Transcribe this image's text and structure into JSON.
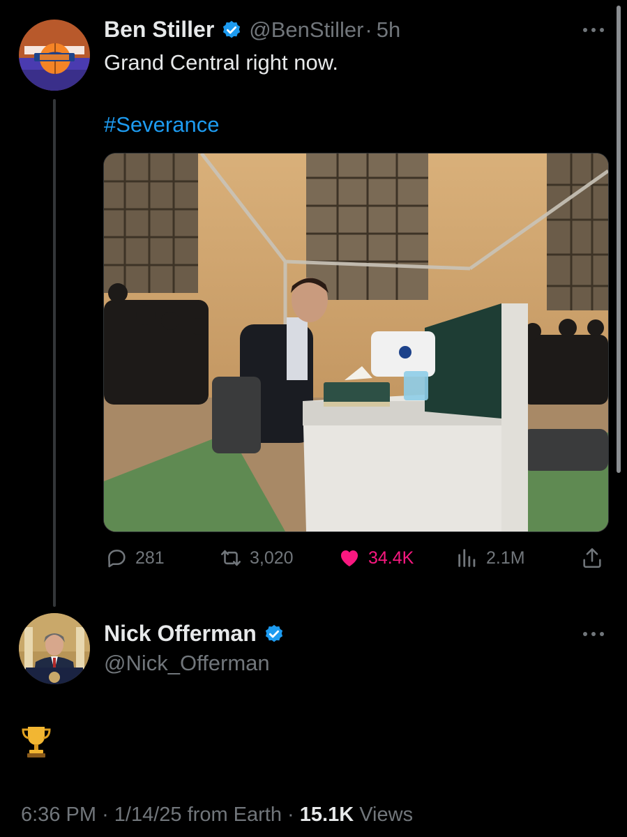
{
  "tweet": {
    "author_name": "Ben Stiller",
    "author_handle": "@BenStiller",
    "separator": "·",
    "time_ago": "5h",
    "text": "Grand Central right now.",
    "hashtag": "#Severance",
    "stats": {
      "replies": "281",
      "retweets": "3,020",
      "likes": "34.4K",
      "views": "2.1M"
    }
  },
  "reply": {
    "author_name": "Nick Offerman",
    "author_handle": "@Nick_Offerman",
    "text": "🏆",
    "timestamp": "6:36 PM",
    "sep1": "·",
    "date": "1/14/25 from Earth",
    "sep2": "·",
    "views_count": "15.1K",
    "views_label": "Views"
  },
  "colors": {
    "background": "#000000",
    "accent_blue": "#1d9bf0",
    "like_pink": "#f91880",
    "muted": "#71767b"
  },
  "icons": [
    "more-icon",
    "verified-badge-icon",
    "reply-icon",
    "retweet-icon",
    "heart-icon",
    "views-icon",
    "share-icon"
  ]
}
